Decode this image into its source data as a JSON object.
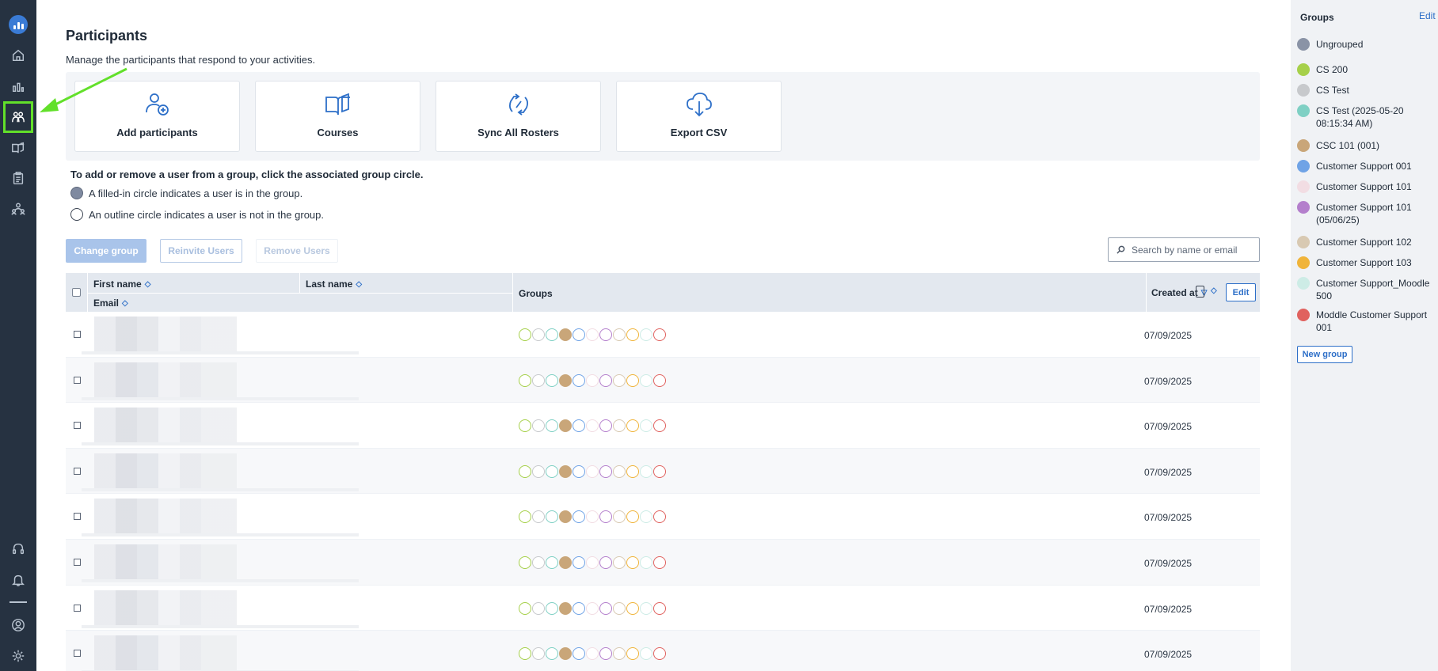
{
  "page": {
    "title": "Participants",
    "subtitle": "Manage the participants that respond to your activities."
  },
  "actions": [
    {
      "label": "Add participants",
      "icon": "add-person-icon"
    },
    {
      "label": "Courses",
      "icon": "book-icon"
    },
    {
      "label": "Sync All Rosters",
      "icon": "sync-icon"
    },
    {
      "label": "Export CSV",
      "icon": "cloud-download-icon"
    }
  ],
  "help": {
    "title": "To add or remove a user from a group, click the associated group circle.",
    "filled": "A filled-in circle indicates a user is in the group.",
    "outline": "An outline circle indicates a user is not in the group."
  },
  "toolbar": {
    "change_group": "Change group",
    "reinvite": "Reinvite Users",
    "remove": "Remove Users",
    "search_placeholder": "Search by name or email"
  },
  "table": {
    "headers": {
      "first_name": "First name",
      "last_name": "Last name",
      "email": "Email",
      "groups": "Groups",
      "created_at": "Created at",
      "edit": "Edit"
    },
    "rows": [
      {
        "created": "07/09/2025",
        "member_of": [
          3
        ]
      },
      {
        "created": "07/09/2025",
        "member_of": [
          3
        ]
      },
      {
        "created": "07/09/2025",
        "member_of": [
          3
        ]
      },
      {
        "created": "07/09/2025",
        "member_of": [
          3
        ]
      },
      {
        "created": "07/09/2025",
        "member_of": [
          3
        ]
      },
      {
        "created": "07/09/2025",
        "member_of": [
          3
        ]
      },
      {
        "created": "07/09/2025",
        "member_of": [
          3
        ]
      },
      {
        "created": "07/09/2025",
        "member_of": [
          3
        ]
      }
    ]
  },
  "groups_panel": {
    "title": "Groups",
    "edit": "Edit",
    "new_group": "New group",
    "ungrouped": {
      "name": "Ungrouped",
      "color": "#8a93a6"
    },
    "items": [
      {
        "name": "CS 200",
        "color": "#a6d04a"
      },
      {
        "name": "CS Test",
        "color": "#c7c9cc"
      },
      {
        "name": "CS Test (2025-05-20 08:15:34 AM)",
        "color": "#7fd0c4"
      },
      {
        "name": "CSC 101 (001)",
        "color": "#c9a679"
      },
      {
        "name": "Customer Support 001",
        "color": "#6fa3e6"
      },
      {
        "name": "Customer Support 101",
        "color": "#f2dde3"
      },
      {
        "name": "Customer Support 101 (05/06/25)",
        "color": "#b47fcc"
      },
      {
        "name": "Customer Support 102",
        "color": "#d8c9b2"
      },
      {
        "name": "Customer Support 103",
        "color": "#f0b43a"
      },
      {
        "name": "Customer Support_Moodle 500",
        "color": "#cdece6"
      },
      {
        "name": "Moddle Customer Support 001",
        "color": "#e0625f"
      }
    ]
  }
}
